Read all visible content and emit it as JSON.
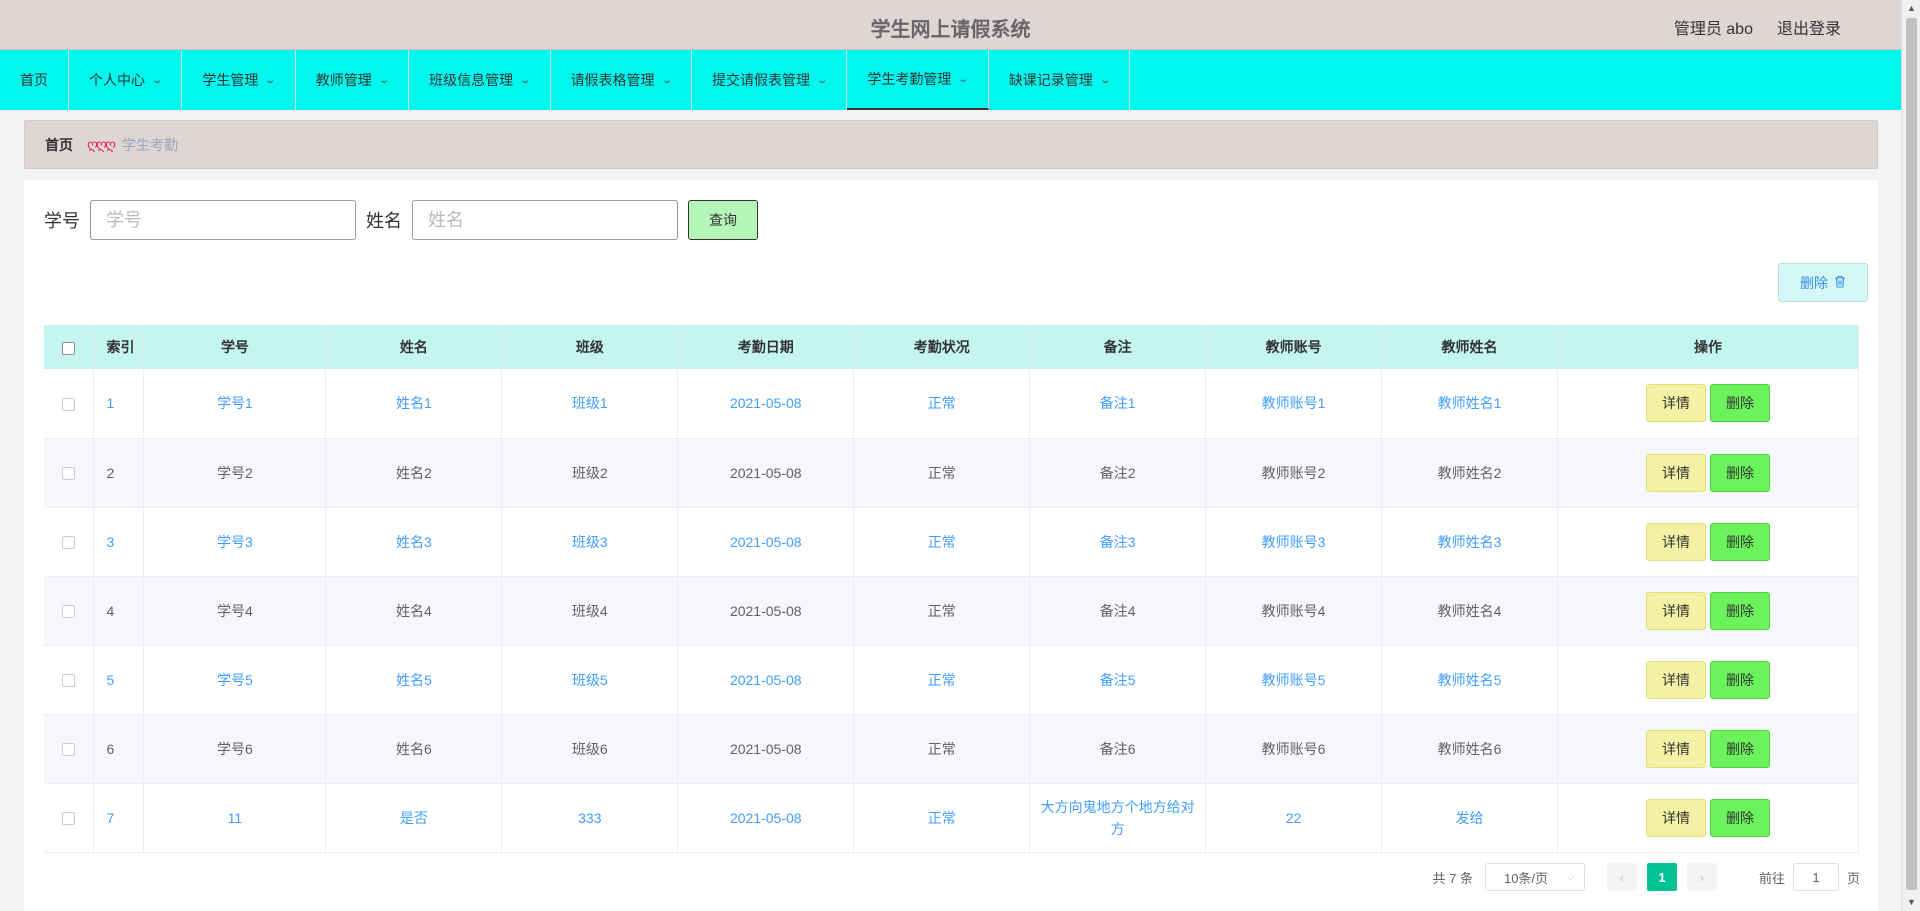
{
  "header": {
    "title": "学生网上请假系统",
    "user": "管理员 abo",
    "logout": "退出登录"
  },
  "nav": [
    {
      "label": "首页",
      "has_dropdown": false
    },
    {
      "label": "个人中心",
      "has_dropdown": true
    },
    {
      "label": "学生管理",
      "has_dropdown": true
    },
    {
      "label": "教师管理",
      "has_dropdown": true
    },
    {
      "label": "班级信息管理",
      "has_dropdown": true
    },
    {
      "label": "请假表格管理",
      "has_dropdown": true
    },
    {
      "label": "提交请假表管理",
      "has_dropdown": true
    },
    {
      "label": "学生考勤管理",
      "has_dropdown": true,
      "active": true
    },
    {
      "label": "缺课记录管理",
      "has_dropdown": true
    }
  ],
  "breadcrumb": {
    "home": "首页",
    "separator": "ღღღ",
    "current": "学生考勤"
  },
  "search": {
    "id_label": "学号",
    "id_placeholder": "学号",
    "name_label": "姓名",
    "name_placeholder": "姓名",
    "query_label": "查询"
  },
  "toolbar": {
    "delete_label": "删除"
  },
  "table": {
    "columns": [
      "索引",
      "学号",
      "姓名",
      "班级",
      "考勤日期",
      "考勤状况",
      "备注",
      "教师账号",
      "教师姓名",
      "操作"
    ],
    "rows": [
      [
        "1",
        "学号1",
        "姓名1",
        "班级1",
        "2021-05-08",
        "正常",
        "备注1",
        "教师账号1",
        "教师姓名1"
      ],
      [
        "2",
        "学号2",
        "姓名2",
        "班级2",
        "2021-05-08",
        "正常",
        "备注2",
        "教师账号2",
        "教师姓名2"
      ],
      [
        "3",
        "学号3",
        "姓名3",
        "班级3",
        "2021-05-08",
        "正常",
        "备注3",
        "教师账号3",
        "教师姓名3"
      ],
      [
        "4",
        "学号4",
        "姓名4",
        "班级4",
        "2021-05-08",
        "正常",
        "备注4",
        "教师账号4",
        "教师姓名4"
      ],
      [
        "5",
        "学号5",
        "姓名5",
        "班级5",
        "2021-05-08",
        "正常",
        "备注5",
        "教师账号5",
        "教师姓名5"
      ],
      [
        "6",
        "学号6",
        "姓名6",
        "班级6",
        "2021-05-08",
        "正常",
        "备注6",
        "教师账号6",
        "教师姓名6"
      ],
      [
        "7",
        "11",
        "是否",
        "333",
        "2021-05-08",
        "正常",
        "大方向鬼地方个地方给对方",
        "22",
        "发给"
      ]
    ],
    "detail_label": "详情",
    "delete_label": "删除"
  },
  "pagination": {
    "total": "共 7 条",
    "page_size": "10条/页",
    "current_page": "1",
    "goto_prefix": "前往",
    "goto_value": "1",
    "goto_suffix": "页"
  }
}
